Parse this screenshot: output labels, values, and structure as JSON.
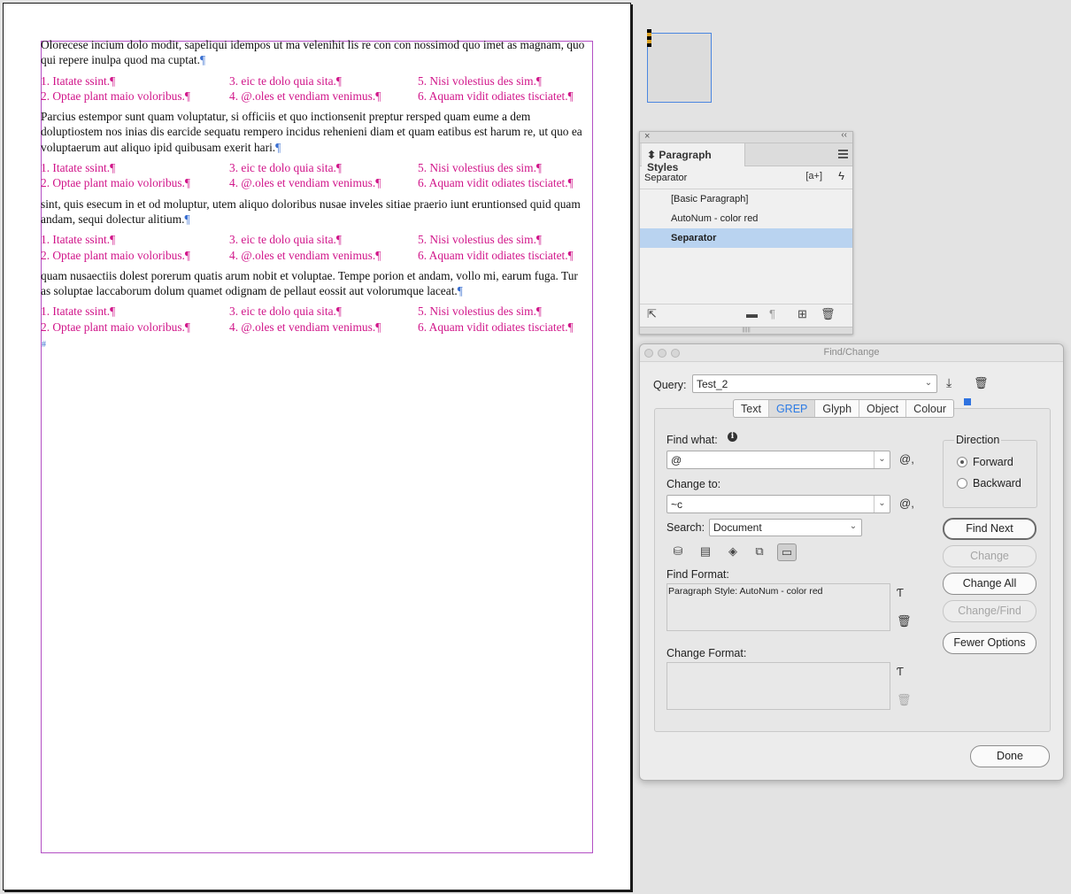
{
  "document": {
    "pilcrow": "¶",
    "paragraphs": [
      "Olorecese incium dolo modit, sapeliqui idempos ut ma velenihit lis re con con nossimod quo imet as mag­nam, quo qui repere inulpa quod ma cuptat.",
      "Parcius estempor sunt quam voluptatur, si officiis et quo inctionsenit preptur rersped quam eume a dem doluptiostem nos inias dis earcide sequatu rempero incidus rehenieni diam et quam eatibus est harum re, ut quo ea voluptaerum aut aliquo ipid quibusam exerit hari.",
      "sint, quis esecum in et od moluptur, utem aliquo doloribus nusae inveles sitiae praerio iunt eruntionsed quid quam andam, sequi dolectur alitium.",
      "quam nusaectiis dolest porerum quatis arum nobit et voluptae. Tempe porion et andam, vollo mi, earum fuga. Tur as soluptae laccaborum dolum quamet odignam de pellaut eossit aut volorumque laceat."
    ],
    "numbered": [
      "1. Itatate ssint.",
      "3. eic te dolo quia sita.",
      "5. Nisi volestius des sim.",
      "2. Optae plant maio voloribus.",
      "4. @.oles et vendiam venimus.",
      "6. Aquam vidit odiates tisciatet."
    ],
    "end_mark": "#"
  },
  "paragraph_styles_panel": {
    "close": "×",
    "collapse": "‹‹",
    "tab_title": "Paragraph Styles",
    "current_style": "Separator",
    "new_style_button": "[a+]",
    "styles": [
      "[Basic Paragraph]",
      "AutoNum - color red",
      "Separator"
    ],
    "selected_style": "Separator"
  },
  "find_change": {
    "title": "Find/Change",
    "query_label": "Query:",
    "query_value": "Test_2",
    "tabs": [
      "Text",
      "GREP",
      "Glyph",
      "Object",
      "Colour"
    ],
    "active_tab": "GREP",
    "find_what_label": "Find what:",
    "find_what_value": "@",
    "change_to_label": "Change to:",
    "change_to_value": "~c",
    "special_char_symbol": "@,",
    "search_label": "Search:",
    "search_value": "Document",
    "find_format_label": "Find Format:",
    "find_format_value": "Paragraph Style: AutoNum - color red",
    "change_format_label": "Change Format:",
    "change_format_value": "",
    "direction_label": "Direction",
    "direction_options": [
      "Forward",
      "Backward"
    ],
    "direction_selected": "Forward",
    "buttons": {
      "find_next": "Find Next",
      "change": "Change",
      "change_all": "Change All",
      "change_find": "Change/Find",
      "fewer_options": "Fewer Options",
      "done": "Done"
    }
  },
  "colors": {
    "numbered_text": "#d1168a",
    "frame_border": "#b34fc4",
    "selection": "#b9d3f0",
    "active_tab": "#2c7be5"
  }
}
